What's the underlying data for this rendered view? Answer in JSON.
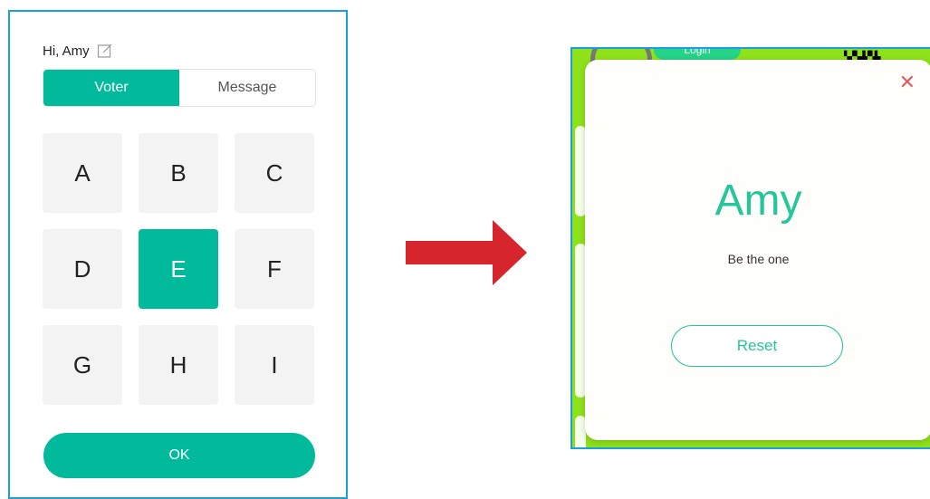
{
  "phone": {
    "greeting": "Hi, Amy",
    "tabs": [
      {
        "label": "Voter",
        "active": true
      },
      {
        "label": "Message",
        "active": false
      }
    ],
    "keys": [
      "A",
      "B",
      "C",
      "D",
      "E",
      "F",
      "G",
      "H",
      "I"
    ],
    "selected_key": "E",
    "ok_label": "OK"
  },
  "screen": {
    "login_label": "Login",
    "dialog": {
      "name": "Amy",
      "tagline": "Be the one",
      "reset_label": "Reset",
      "close_glyph": "✕"
    }
  },
  "colors": {
    "accent": "#00ba9b",
    "dialog_accent": "#23c79a",
    "arrow": "#d6252c",
    "border": "#1a9fe0",
    "screen_bg": "#8fe21a"
  }
}
